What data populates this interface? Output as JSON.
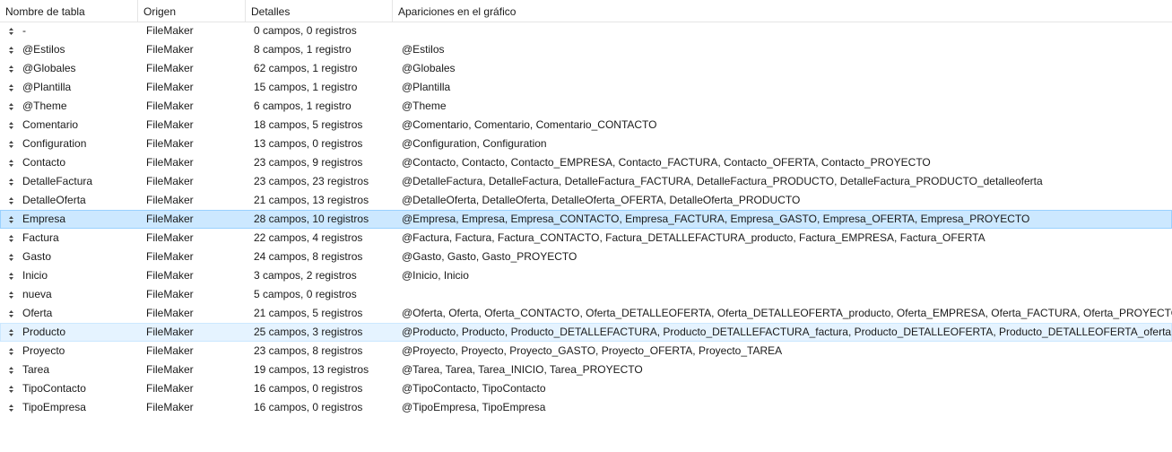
{
  "columns": {
    "name": "Nombre de tabla",
    "origin": "Origen",
    "details": "Detalles",
    "appearances": "Apariciones en el gráfico"
  },
  "rows": [
    {
      "name": "-",
      "origin": "FileMaker",
      "details": "0 campos, 0 registros",
      "appearances": ""
    },
    {
      "name": "@Estilos",
      "origin": "FileMaker",
      "details": "8 campos, 1 registro",
      "appearances": "@Estilos"
    },
    {
      "name": "@Globales",
      "origin": "FileMaker",
      "details": "62 campos, 1 registro",
      "appearances": "@Globales"
    },
    {
      "name": "@Plantilla",
      "origin": "FileMaker",
      "details": "15 campos, 1 registro",
      "appearances": "@Plantilla"
    },
    {
      "name": "@Theme",
      "origin": "FileMaker",
      "details": "6 campos, 1 registro",
      "appearances": "@Theme"
    },
    {
      "name": "Comentario",
      "origin": "FileMaker",
      "details": "18 campos, 5 registros",
      "appearances": "@Comentario, Comentario, Comentario_CONTACTO"
    },
    {
      "name": "Configuration",
      "origin": "FileMaker",
      "details": "13 campos, 0 registros",
      "appearances": "@Configuration, Configuration"
    },
    {
      "name": "Contacto",
      "origin": "FileMaker",
      "details": "23 campos, 9 registros",
      "appearances": "@Contacto, Contacto, Contacto_EMPRESA, Contacto_FACTURA, Contacto_OFERTA, Contacto_PROYECTO"
    },
    {
      "name": "DetalleFactura",
      "origin": "FileMaker",
      "details": "23 campos, 23 registros",
      "appearances": "@DetalleFactura, DetalleFactura, DetalleFactura_FACTURA, DetalleFactura_PRODUCTO, DetalleFactura_PRODUCTO_detalleoferta"
    },
    {
      "name": "DetalleOferta",
      "origin": "FileMaker",
      "details": "21 campos, 13 registros",
      "appearances": "@DetalleOferta, DetalleOferta, DetalleOferta_OFERTA, DetalleOferta_PRODUCTO"
    },
    {
      "name": "Empresa",
      "origin": "FileMaker",
      "details": "28 campos, 10 registros",
      "appearances": "@Empresa, Empresa, Empresa_CONTACTO, Empresa_FACTURA, Empresa_GASTO, Empresa_OFERTA, Empresa_PROYECTO",
      "state": "selected"
    },
    {
      "name": "Factura",
      "origin": "FileMaker",
      "details": "22 campos, 4 registros",
      "appearances": "@Factura, Factura, Factura_CONTACTO, Factura_DETALLEFACTURA_producto, Factura_EMPRESA, Factura_OFERTA"
    },
    {
      "name": "Gasto",
      "origin": "FileMaker",
      "details": "24 campos, 8 registros",
      "appearances": "@Gasto, Gasto, Gasto_PROYECTO"
    },
    {
      "name": "Inicio",
      "origin": "FileMaker",
      "details": "3 campos, 2 registros",
      "appearances": "@Inicio, Inicio"
    },
    {
      "name": "nueva",
      "origin": "FileMaker",
      "details": "5 campos, 0 registros",
      "appearances": ""
    },
    {
      "name": "Oferta",
      "origin": "FileMaker",
      "details": "21 campos, 5 registros",
      "appearances": "@Oferta, Oferta, Oferta_CONTACTO, Oferta_DETALLEOFERTA, Oferta_DETALLEOFERTA_producto, Oferta_EMPRESA, Oferta_FACTURA, Oferta_PROYECTO"
    },
    {
      "name": "Producto",
      "origin": "FileMaker",
      "details": "25 campos, 3 registros",
      "appearances": "@Producto, Producto, Producto_DETALLEFACTURA, Producto_DETALLEFACTURA_factura, Producto_DETALLEOFERTA, Producto_DETALLEOFERTA_oferta",
      "state": "hover"
    },
    {
      "name": "Proyecto",
      "origin": "FileMaker",
      "details": "23 campos, 8 registros",
      "appearances": "@Proyecto, Proyecto, Proyecto_GASTO, Proyecto_OFERTA, Proyecto_TAREA"
    },
    {
      "name": "Tarea",
      "origin": "FileMaker",
      "details": "19 campos, 13 registros",
      "appearances": "@Tarea, Tarea, Tarea_INICIO, Tarea_PROYECTO"
    },
    {
      "name": "TipoContacto",
      "origin": "FileMaker",
      "details": "16 campos, 0 registros",
      "appearances": "@TipoContacto, TipoContacto"
    },
    {
      "name": "TipoEmpresa",
      "origin": "FileMaker",
      "details": "16 campos, 0 registros",
      "appearances": "@TipoEmpresa, TipoEmpresa"
    }
  ],
  "colors": {
    "selected_bg": "#cce8ff",
    "selected_border": "#99d1ff",
    "hover_bg": "#e5f3ff",
    "grid_line": "#e5e5e5",
    "text": "#1a1a1a"
  },
  "icons": {
    "row_handle": "drag-handle-icon"
  }
}
